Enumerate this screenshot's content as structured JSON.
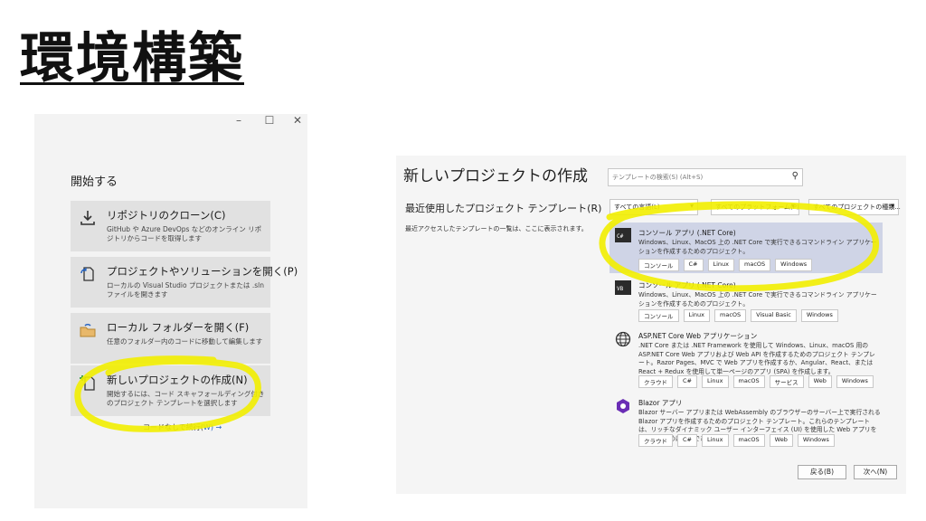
{
  "slide": {
    "title": "環境構築"
  },
  "start": {
    "window_controls": [
      "–",
      "☐",
      "✕"
    ],
    "heading": "開始する",
    "cards": [
      {
        "title": "リポジトリのクローン(C)",
        "desc": "GitHub や Azure DevOps などのオンライン リポジトリからコードを取得します",
        "icon": "clone-icon"
      },
      {
        "title": "プロジェクトやソリューションを開く(P)",
        "desc": "ローカルの Visual Studio プロジェクトまたは .sln ファイルを開きます",
        "icon": "open-project-icon"
      },
      {
        "title": "ローカル フォルダーを開く(F)",
        "desc": "任意のフォルダー内のコードに移動して編集します",
        "icon": "folder-icon"
      },
      {
        "title": "新しいプロジェクトの作成(N)",
        "desc": "開始するには、コード スキャフォールディング付きのプロジェクト テンプレートを選択します",
        "icon": "new-project-icon"
      }
    ],
    "continue_link": "コードなしで続行(",
    "continue_key": "W",
    "continue_end": ") →"
  },
  "new_project": {
    "title": "新しいプロジェクトの作成",
    "search_placeholder": "テンプレートの検索(S) (Alt+S)",
    "recent_heading": "最近使用したプロジェクト テンプレート(R)",
    "recent_desc": "最近アクセスしたテンプレートの一覧は、ここに表示されます。",
    "filters": [
      "すべての言語(L)",
      "すべてのプラットフォーム(P)",
      "すべてのプロジェクトの種類..."
    ],
    "templates": [
      {
        "name": "コンソール アプリ (.NET Core)",
        "desc": "Windows、Linux、MacOS 上の .NET Core で実行できるコマンドライン アプリケーションを作成するためのプロジェクト。",
        "tags": [
          "コンソール",
          "C#",
          "Linux",
          "macOS",
          "Windows"
        ],
        "selected": true
      },
      {
        "name": "コンソール アプリ (.NET Core)",
        "desc": "Windows、Linux、MacOS 上の .NET Core で実行できるコマンドライン アプリケーションを作成するためのプロジェクト。",
        "tags": [
          "コンソール",
          "Linux",
          "macOS",
          "Visual Basic",
          "Windows"
        ],
        "selected": false
      },
      {
        "name": "ASP.NET Core Web アプリケーション",
        "desc": ".NET Core または .NET Framework を使用して Windows、Linux、macOS 用の ASP.NET Core Web アプリおよび Web API を作成するためのプロジェクト テンプレート。Razor Pages、MVC で Web アプリを作成するか、Angular、React、または React + Redux を使用して単一ページのアプリ (SPA) を作成します。",
        "tags": [
          "クラウド",
          "C#",
          "Linux",
          "macOS",
          "サービス",
          "Web",
          "Windows"
        ],
        "selected": false
      },
      {
        "name": "Blazor アプリ",
        "desc": "Blazor サーバー アプリまたは WebAssembly のブラウザーのサーバー上で実行される Blazor アプリを作成するためのプロジェクト テンプレート。これらのテンプレートは、リッチなダイナミック ユーザー インターフェイス (UI) を使用した Web アプリを構築するために使用できます。",
        "tags": [
          "クラウド",
          "C#",
          "Linux",
          "macOS",
          "Web",
          "Windows"
        ],
        "selected": false
      }
    ],
    "back_button": "戻る(B)",
    "next_button": "次へ(N)"
  },
  "colors": {
    "highlight": "#f2ee00",
    "selected_row": "#cfd4e6",
    "link": "#1f5fbf"
  }
}
